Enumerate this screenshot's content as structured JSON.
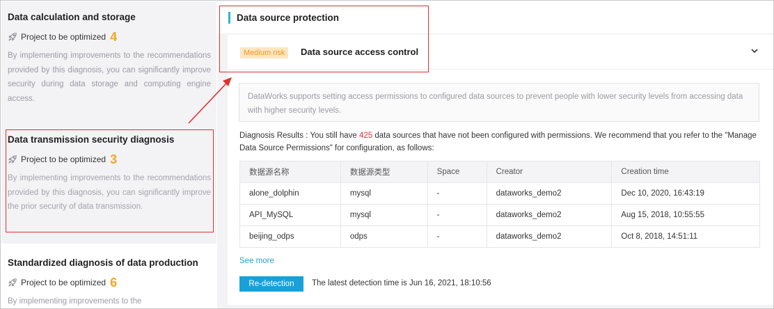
{
  "left_cards": [
    {
      "title": "Data calculation and storage",
      "status": "Project to be optimized",
      "count": "4",
      "description": "By implementing improvements to the recommendations provided by this diagnosis, you can significantly improve security during data storage and computing engine access."
    },
    {
      "title": "Data transmission security diagnosis",
      "status": "Project to be optimized",
      "count": "3",
      "description": "By implementing improvements to the recommendations provided by this diagnosis, you can significantly improve the prior security of data transmission."
    },
    {
      "title": "Standardized diagnosis of data production",
      "status": "Project to be optimized",
      "count": "6",
      "description": "By implementing improvements to the"
    }
  ],
  "section": {
    "title": "Data source protection"
  },
  "panel": {
    "risk_tag": "Medium risk",
    "title": "Data source access control",
    "info": "DataWorks supports setting access permissions to configured data sources to prevent people with lower security levels from accessing data with higher security levels.",
    "diag_label": "Diagnosis Results :",
    "diag_pre": "You still have",
    "diag_count": "425",
    "diag_post": "data sources that have not been configured with permissions. We recommend that you refer to the \"Manage Data Source Permissions\" for configuration, as follows:",
    "table": {
      "headers": [
        "数据源名称",
        "数据源类型",
        "Space",
        "Creator",
        "Creation time"
      ],
      "rows": [
        [
          "alone_dolphin",
          "mysql",
          "-",
          "dataworks_demo2",
          "Dec 10, 2020, 16:43:19"
        ],
        [
          "API_MySQL",
          "mysql",
          "-",
          "dataworks_demo2",
          "Aug 15, 2018, 10:55:55"
        ],
        [
          "beijing_odps",
          "odps",
          "-",
          "dataworks_demo2",
          "Oct 8, 2018, 14:51:11"
        ]
      ]
    },
    "see_more": "See more",
    "redetect_label": "Re-detection",
    "latest_detection": "The latest detection time is Jun 16, 2021, 18:10:56"
  },
  "colors": {
    "accent": "#1aa0d9",
    "section_bar": "#2fb5d3",
    "count_orange": "#f5a623",
    "highlight_red": "#e03030",
    "risk_tag_bg": "#fde6c2",
    "risk_tag_text": "#f0961e"
  },
  "icons": {
    "status": "rocket-icon",
    "expand": "chevron-down-icon"
  }
}
